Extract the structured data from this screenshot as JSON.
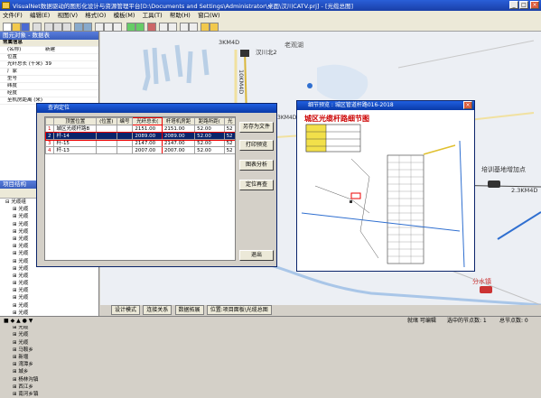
{
  "window": {
    "title": "VisualNet数据驱动的图形化设计与资源管理平台[D:\\Documents and Settings\\Administrator\\桌面\\汉川CATV.prj] - [光缆总图]"
  },
  "menu": [
    "文件(F)",
    "编辑(E)",
    "视图(V)",
    "格式(O)",
    "模板(M)",
    "工具(T)",
    "帮助(H)",
    "窗口(W)"
  ],
  "left_panel": {
    "title": "图元对象 - 数据表",
    "group": "常属信息",
    "props": [
      {
        "k": "(名称)",
        "v": "新建"
      },
      {
        "k": "位置",
        "v": ""
      },
      {
        "k": "光纤总长 (千米)",
        "v": "39"
      },
      {
        "k": "厂家",
        "v": ""
      },
      {
        "k": "型号",
        "v": ""
      },
      {
        "k": "纬度",
        "v": ""
      },
      {
        "k": "经度",
        "v": ""
      },
      {
        "k": "至机房距离 (米)",
        "v": ""
      }
    ],
    "tree_title": "项目结构",
    "tree": [
      "光缆组",
      "光缆",
      "光缆",
      "光缆",
      "光缆",
      "光缆",
      "光缆",
      "光缆",
      "光缆",
      "光缆",
      "光缆",
      "光缆",
      "光缆",
      "光缆",
      "光缆",
      "光缆",
      "光缆",
      "光缆",
      "光缆",
      "光缆",
      "马鞍乡",
      "新堰",
      "湾潭乡",
      "城乡",
      "杨林沟镇",
      "西江乡",
      "南河乡镇"
    ]
  },
  "map": {
    "labels": {
      "l1": "3KM4D",
      "l2": "汉川北2",
      "l3": "老观湖",
      "l4": "10KM4D",
      "l5": "3KM4D",
      "l6": "培训基地增加点",
      "l7": "2.3KM4D",
      "l8": "分水镇",
      "l9": "场"
    }
  },
  "query_dialog": {
    "title": "查询定位",
    "headers": [
      "",
      "顶置位置",
      "(位置)",
      "编号",
      "光纤总长(",
      "杆塔机房距",
      "距路所距(",
      "光"
    ],
    "rows": [
      [
        "1",
        "城区光缆杆路B",
        "",
        "",
        "2151.00",
        "2151.00",
        "52.00",
        "52"
      ],
      [
        "2",
        "杆-14",
        "",
        "",
        "2089.00",
        "2089.00",
        "52.00",
        "52"
      ],
      [
        "3",
        "杆-15",
        "",
        "",
        "2147.00",
        "2147.00",
        "52.00",
        "52"
      ],
      [
        "4",
        "杆-13",
        "",
        "",
        "2007.00",
        "2007.00",
        "52.00",
        "52"
      ]
    ],
    "buttons": {
      "save": "另存为文件",
      "print": "打印预览",
      "chart": "图表分析",
      "position": "定位再查",
      "exit": "退出"
    }
  },
  "preview": {
    "title": "细节预览 : 城区管道杆路016-2018",
    "doc_title": "城区光缆杆路细节图"
  },
  "bottom_tabs": [
    "设计模式",
    "连接关系",
    "数据拓展",
    "位置:项目面板\\光缆总图"
  ],
  "status": {
    "ready": "就绪",
    "tip": "就绪 可编辑",
    "selected": "选中的节点数: 1",
    "total": "总节点数: 0"
  }
}
